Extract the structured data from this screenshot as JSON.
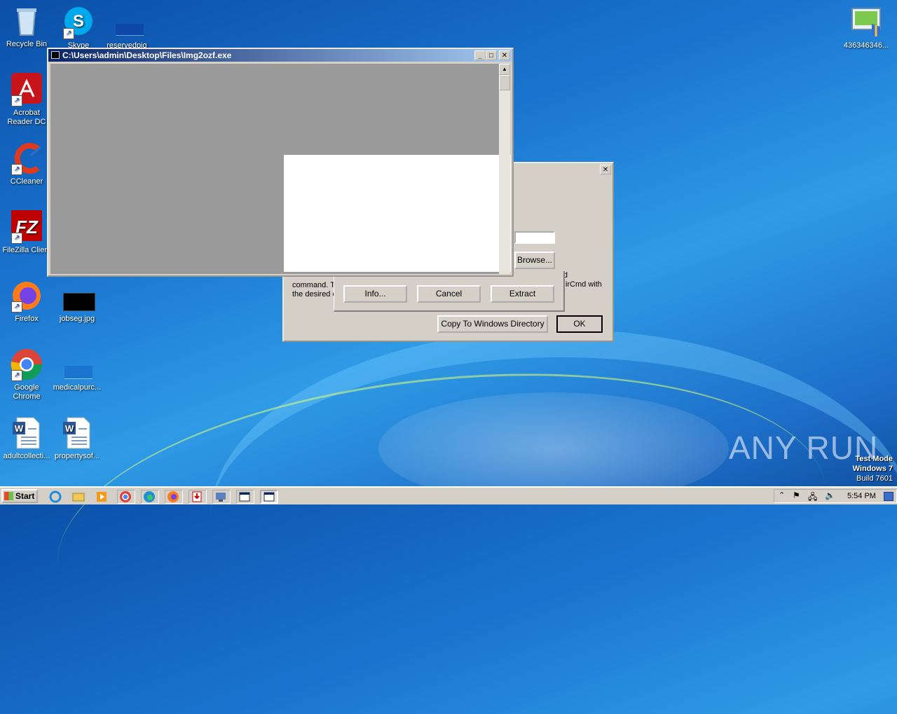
{
  "desktop": {
    "icons": [
      {
        "label": "Recycle Bin"
      },
      {
        "label": "Skype"
      },
      {
        "label": "reservedpig"
      },
      {
        "label": "Acrobat Reader DC"
      },
      {
        "label": "CCleaner"
      },
      {
        "label": "FileZilla Client"
      },
      {
        "label": "Firefox"
      },
      {
        "label": "jobseg.jpg"
      },
      {
        "label": "Google Chrome"
      },
      {
        "label": "medicalpurc..."
      },
      {
        "label": "adultcollecti..."
      },
      {
        "label": "propertysof..."
      },
      {
        "label": "436346346..."
      }
    ],
    "watermark": {
      "text": "ANY RUN"
    },
    "os_info": {
      "line1": "Test Mode",
      "line2": "Windows 7",
      "line3": "Build 7601"
    }
  },
  "console_window": {
    "title": "C:\\Users\\admin\\Desktop\\Files\\Img2ozf.exe"
  },
  "dialog": {
    "text_left_line1": "command. T",
    "text_left_line2": "the desired c",
    "text_right_line1": "lid",
    "text_right_line2": "NirCmd with",
    "browse_label": "Browse...",
    "info_label": "Info...",
    "cancel_label": "Cancel",
    "extract_label": "Extract",
    "copy_label": "Copy To Windows Directory",
    "ok_label": "OK"
  },
  "taskbar": {
    "start_label": "Start",
    "clock": "5:54 PM"
  }
}
